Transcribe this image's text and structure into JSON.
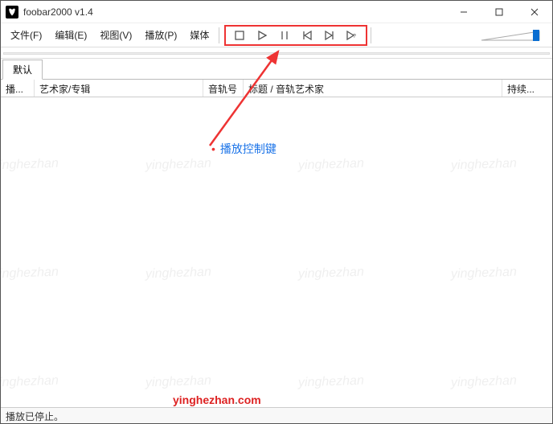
{
  "title": "foobar2000 v1.4",
  "menu": {
    "file": "文件(F)",
    "edit": "编辑(E)",
    "view": "视图(V)",
    "playback": "播放(P)",
    "library": "媒体"
  },
  "controls": {
    "stop": "stop",
    "play": "play",
    "pause": "pause",
    "prev": "prev",
    "next": "next",
    "random": "random"
  },
  "tabs": {
    "default": "默认"
  },
  "columns": {
    "playing": "播...",
    "artist_album": "艺术家/专辑",
    "trackno": "音轨号",
    "title_artist": "标题 / 音轨艺术家",
    "duration": "持续..."
  },
  "status": "播放已停止。",
  "annotation": {
    "label": "播放控制键"
  },
  "watermark": {
    "text": "yinghezhan",
    "url_p1": "yinghezhan",
    "url_p2": ".",
    "url_p3": "com"
  }
}
